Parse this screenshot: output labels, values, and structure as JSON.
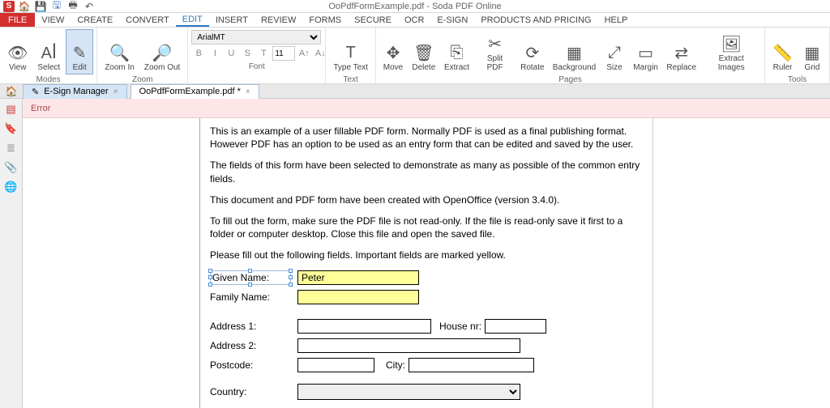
{
  "titlebar": {
    "app_logo_letter": "S",
    "qat_icons": [
      "home-icon",
      "save-icon",
      "save-as-icon",
      "print-icon",
      "undo-icon"
    ],
    "title": "OoPdfFormExample.pdf - Soda PDF Online"
  },
  "menu": {
    "file_label": "FILE",
    "tabs": [
      "VIEW",
      "CREATE",
      "CONVERT",
      "EDIT",
      "INSERT",
      "REVIEW",
      "FORMS",
      "SECURE",
      "OCR",
      "E-SIGN",
      "PRODUCTS AND PRICING",
      "HELP"
    ],
    "active_tab_index": 3
  },
  "ribbon": {
    "groups": {
      "modes": {
        "label": "Modes",
        "btns": [
          {
            "icon": "👁",
            "label": "View",
            "name": "view-button"
          },
          {
            "icon": "Aꟾ",
            "label": "Select",
            "name": "select-button"
          },
          {
            "icon": "✎",
            "label": "Edit",
            "name": "edit-button",
            "active": true
          }
        ]
      },
      "zoom": {
        "label": "Zoom",
        "btns": [
          {
            "icon": "🔍",
            "label": "Zoom\nIn",
            "name": "zoom-in-button"
          },
          {
            "icon": "🔎",
            "label": "Zoom\nOut",
            "name": "zoom-out-button"
          }
        ]
      },
      "font": {
        "label": "Font",
        "font_name": "ArialMT",
        "font_size": "11",
        "style_btns": [
          "B",
          "I",
          "U",
          "S",
          "T"
        ],
        "size_btns": [
          "A↑",
          "A↓"
        ]
      },
      "text": {
        "label": "Text",
        "btns": [
          {
            "icon": "T",
            "label": "Type\nText",
            "name": "type-text-button"
          }
        ]
      },
      "pages": {
        "label": "Pages",
        "btns": [
          {
            "icon": "✥",
            "label": "Move",
            "name": "move-button"
          },
          {
            "icon": "🗑",
            "label": "Delete",
            "name": "delete-button"
          },
          {
            "icon": "⎘",
            "label": "Extract",
            "name": "extract-button"
          },
          {
            "icon": "✂",
            "label": "Split\nPDF",
            "name": "split-pdf-button"
          },
          {
            "icon": "⟳",
            "label": "Rotate",
            "name": "rotate-button"
          },
          {
            "icon": "▦",
            "label": "Background",
            "name": "background-button"
          },
          {
            "icon": "⤢",
            "label": "Size",
            "name": "size-button"
          },
          {
            "icon": "▭",
            "label": "Margin",
            "name": "margin-button"
          },
          {
            "icon": "⇄",
            "label": "Replace",
            "name": "replace-button"
          },
          {
            "icon": "🖼",
            "label": "Extract\nImages",
            "name": "extract-images-button"
          }
        ]
      },
      "tools": {
        "label": "Tools",
        "btns": [
          {
            "icon": "📏",
            "label": "Ruler",
            "name": "ruler-button"
          },
          {
            "icon": "▦",
            "label": "Grid",
            "name": "grid-button"
          }
        ]
      }
    }
  },
  "doctabs": {
    "tabs": [
      {
        "icon": "✎",
        "label": "E-Sign Manager",
        "active": false,
        "name": "doc-tab-esign"
      },
      {
        "icon": "",
        "label": "OoPdfFormExample.pdf *",
        "active": true,
        "name": "doc-tab-document"
      }
    ]
  },
  "sidebar": {
    "icons": [
      "thumbnails-icon",
      "bookmarks-icon",
      "layers-icon",
      "attachments-icon",
      "comments-icon"
    ]
  },
  "errorbar": {
    "text": "Error"
  },
  "document": {
    "p1": "This is an example of a user fillable PDF form. Normally PDF is used as a final publishing format. However PDF has an option to be used as an entry form that can be edited and saved by the user.",
    "p2": "The fields of this form have been selected to demonstrate as many as possible of the common entry fields.",
    "p3": "This document and PDF form have been created with OpenOffice (version 3.4.0).",
    "p4": "To fill out the form, make sure the PDF file is not read-only. If the file is read-only save it first to a folder or computer desktop. Close this file and open the saved file.",
    "p5": "Please fill out the following fields. Important fields are marked yellow.",
    "fields": {
      "given_name": {
        "label": "Given Name:",
        "value": "Peter"
      },
      "family_name": {
        "label": "Family Name:",
        "value": ""
      },
      "address1": {
        "label": "Address 1:",
        "value": ""
      },
      "house_nr": {
        "label": "House nr:",
        "value": ""
      },
      "address2": {
        "label": "Address 2:",
        "value": ""
      },
      "postcode": {
        "label": "Postcode:",
        "value": ""
      },
      "city": {
        "label": "City:",
        "value": ""
      },
      "country": {
        "label": "Country:",
        "value": ""
      }
    }
  }
}
